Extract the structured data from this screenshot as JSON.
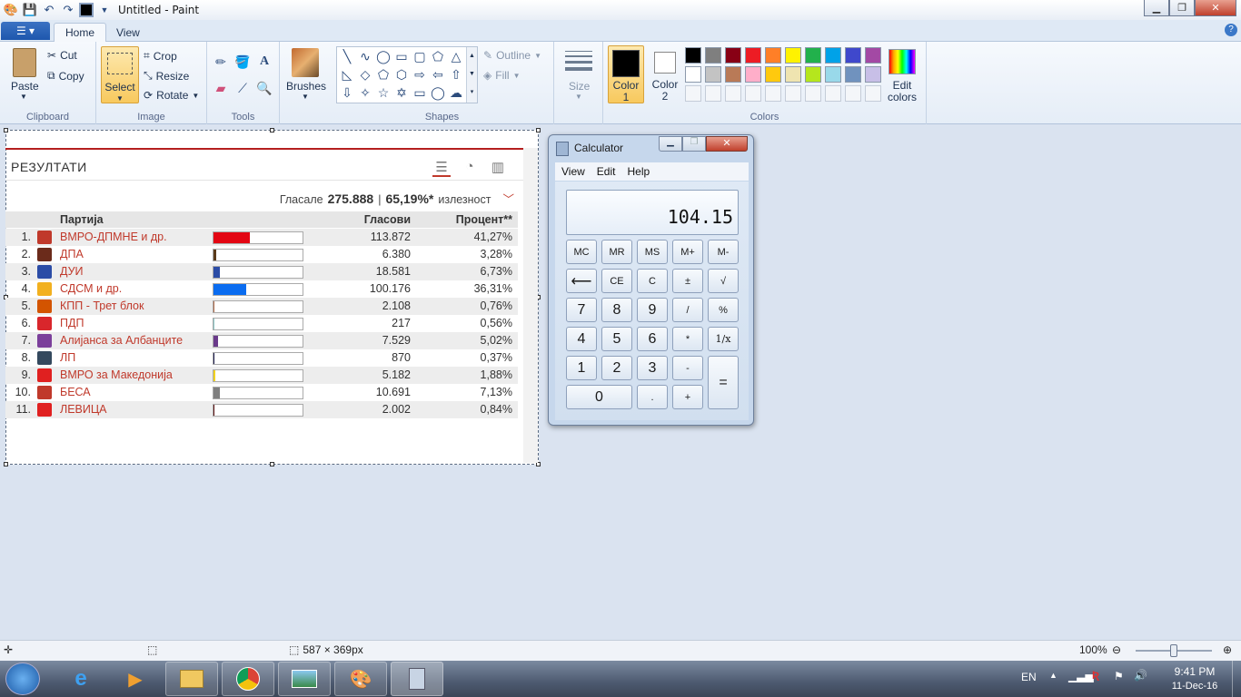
{
  "window": {
    "title": "Untitled - Paint"
  },
  "ribbon_tabs": [
    "Home",
    "View"
  ],
  "clipboard": {
    "paste": "Paste",
    "cut": "Cut",
    "copy": "Copy",
    "group": "Clipboard"
  },
  "image": {
    "select": "Select",
    "crop": "Crop",
    "resize": "Resize",
    "rotate": "Rotate",
    "group": "Image"
  },
  "tools": {
    "group": "Tools"
  },
  "brushes": {
    "label": "Brushes"
  },
  "shapes": {
    "outline": "Outline",
    "fill": "Fill",
    "group": "Shapes"
  },
  "size": {
    "label": "Size"
  },
  "colors": {
    "color1_label": "Color\n1",
    "color2_label": "Color\n2",
    "group": "Colors",
    "edit_colors": "Edit\ncolors",
    "color1": "#000000",
    "color2": "#ffffff",
    "palette_row1": [
      "#000000",
      "#7f7f7f",
      "#880015",
      "#ed1c24",
      "#ff7f27",
      "#fff200",
      "#22b14c",
      "#00a2e8",
      "#3f48cc",
      "#a349a4"
    ],
    "palette_row2": [
      "#ffffff",
      "#c3c3c3",
      "#b97a57",
      "#ffaec9",
      "#ffc90e",
      "#efe4b0",
      "#b5e61d",
      "#99d9ea",
      "#7092be",
      "#c8bfe7"
    ]
  },
  "results": {
    "title": "РЕЗУЛТАТИ",
    "voted_label": "Гласале",
    "voted_value": "275.888",
    "sep": "|",
    "turnout_value": "65,19%*",
    "turnout_label": "излезност",
    "headers": {
      "party": "Партија",
      "votes": "Гласови",
      "percent": "Процент**"
    },
    "rows": [
      {
        "n": "1.",
        "name": "ВМРО-ДПМНЕ и др.",
        "votes": "113.872",
        "pct": "41,27%",
        "share": 0.4127,
        "color": "#e30613",
        "logo": "#c0392b"
      },
      {
        "n": "2.",
        "name": "ДПА",
        "votes": "6.380",
        "pct": "3,28%",
        "share": 0.0328,
        "color": "#5a3a1a",
        "logo": "#6b2b1b"
      },
      {
        "n": "3.",
        "name": "ДУИ",
        "votes": "18.581",
        "pct": "6,73%",
        "share": 0.0673,
        "color": "#2b4ca6",
        "logo": "#2b4ca6"
      },
      {
        "n": "4.",
        "name": "СДСМ и др.",
        "votes": "100.176",
        "pct": "36,31%",
        "share": 0.3631,
        "color": "#0a6cf0",
        "logo": "#f2b01e"
      },
      {
        "n": "5.",
        "name": "КПП - Трет блок",
        "votes": "2.108",
        "pct": "0,76%",
        "share": 0.0076,
        "color": "#b06b4a",
        "logo": "#d35400"
      },
      {
        "n": "6.",
        "name": "ПДП",
        "votes": "217",
        "pct": "0,56%",
        "share": 0.0056,
        "color": "#8fc9c9",
        "logo": "#d9262c"
      },
      {
        "n": "7.",
        "name": "Алијанса за Албанците",
        "votes": "7.529",
        "pct": "5,02%",
        "share": 0.0502,
        "color": "#6a3a8a",
        "logo": "#7b3f9b"
      },
      {
        "n": "8.",
        "name": "ЛП",
        "votes": "870",
        "pct": "0,37%",
        "share": 0.0037,
        "color": "#1a1a4a",
        "logo": "#34495e"
      },
      {
        "n": "9.",
        "name": "ВМРО за Македонија",
        "votes": "5.182",
        "pct": "1,88%",
        "share": 0.0188,
        "color": "#f2d21e",
        "logo": "#e02020"
      },
      {
        "n": "10.",
        "name": "БЕСА",
        "votes": "10.691",
        "pct": "7,13%",
        "share": 0.0713,
        "color": "#7f7f7f",
        "logo": "#c0392b"
      },
      {
        "n": "11.",
        "name": "ЛЕВИЦА",
        "votes": "2.002",
        "pct": "0,84%",
        "share": 0.0084,
        "color": "#5a1010",
        "logo": "#e02020"
      }
    ]
  },
  "calculator": {
    "title": "Calculator",
    "menu": [
      "View",
      "Edit",
      "Help"
    ],
    "display": "104.15",
    "keys": {
      "mc": "MC",
      "mr": "MR",
      "ms": "MS",
      "mplus": "M+",
      "mminus": "M-",
      "back": "⟵",
      "ce": "CE",
      "c": "C",
      "pm": "±",
      "sqrt": "√",
      "k7": "7",
      "k8": "8",
      "k9": "9",
      "div": "/",
      "pct": "%",
      "k4": "4",
      "k5": "5",
      "k6": "6",
      "mul": "*",
      "inv": "1/x",
      "k1": "1",
      "k2": "2",
      "k3": "3",
      "sub": "-",
      "eq": "=",
      "k0": "0",
      "dot": ".",
      "add": "+"
    }
  },
  "statusbar": {
    "dimensions": "587 × 369px",
    "zoom": "100%"
  },
  "taskbar": {
    "lang": "EN",
    "time": "9:41 PM",
    "date": "11-Dec-16"
  }
}
